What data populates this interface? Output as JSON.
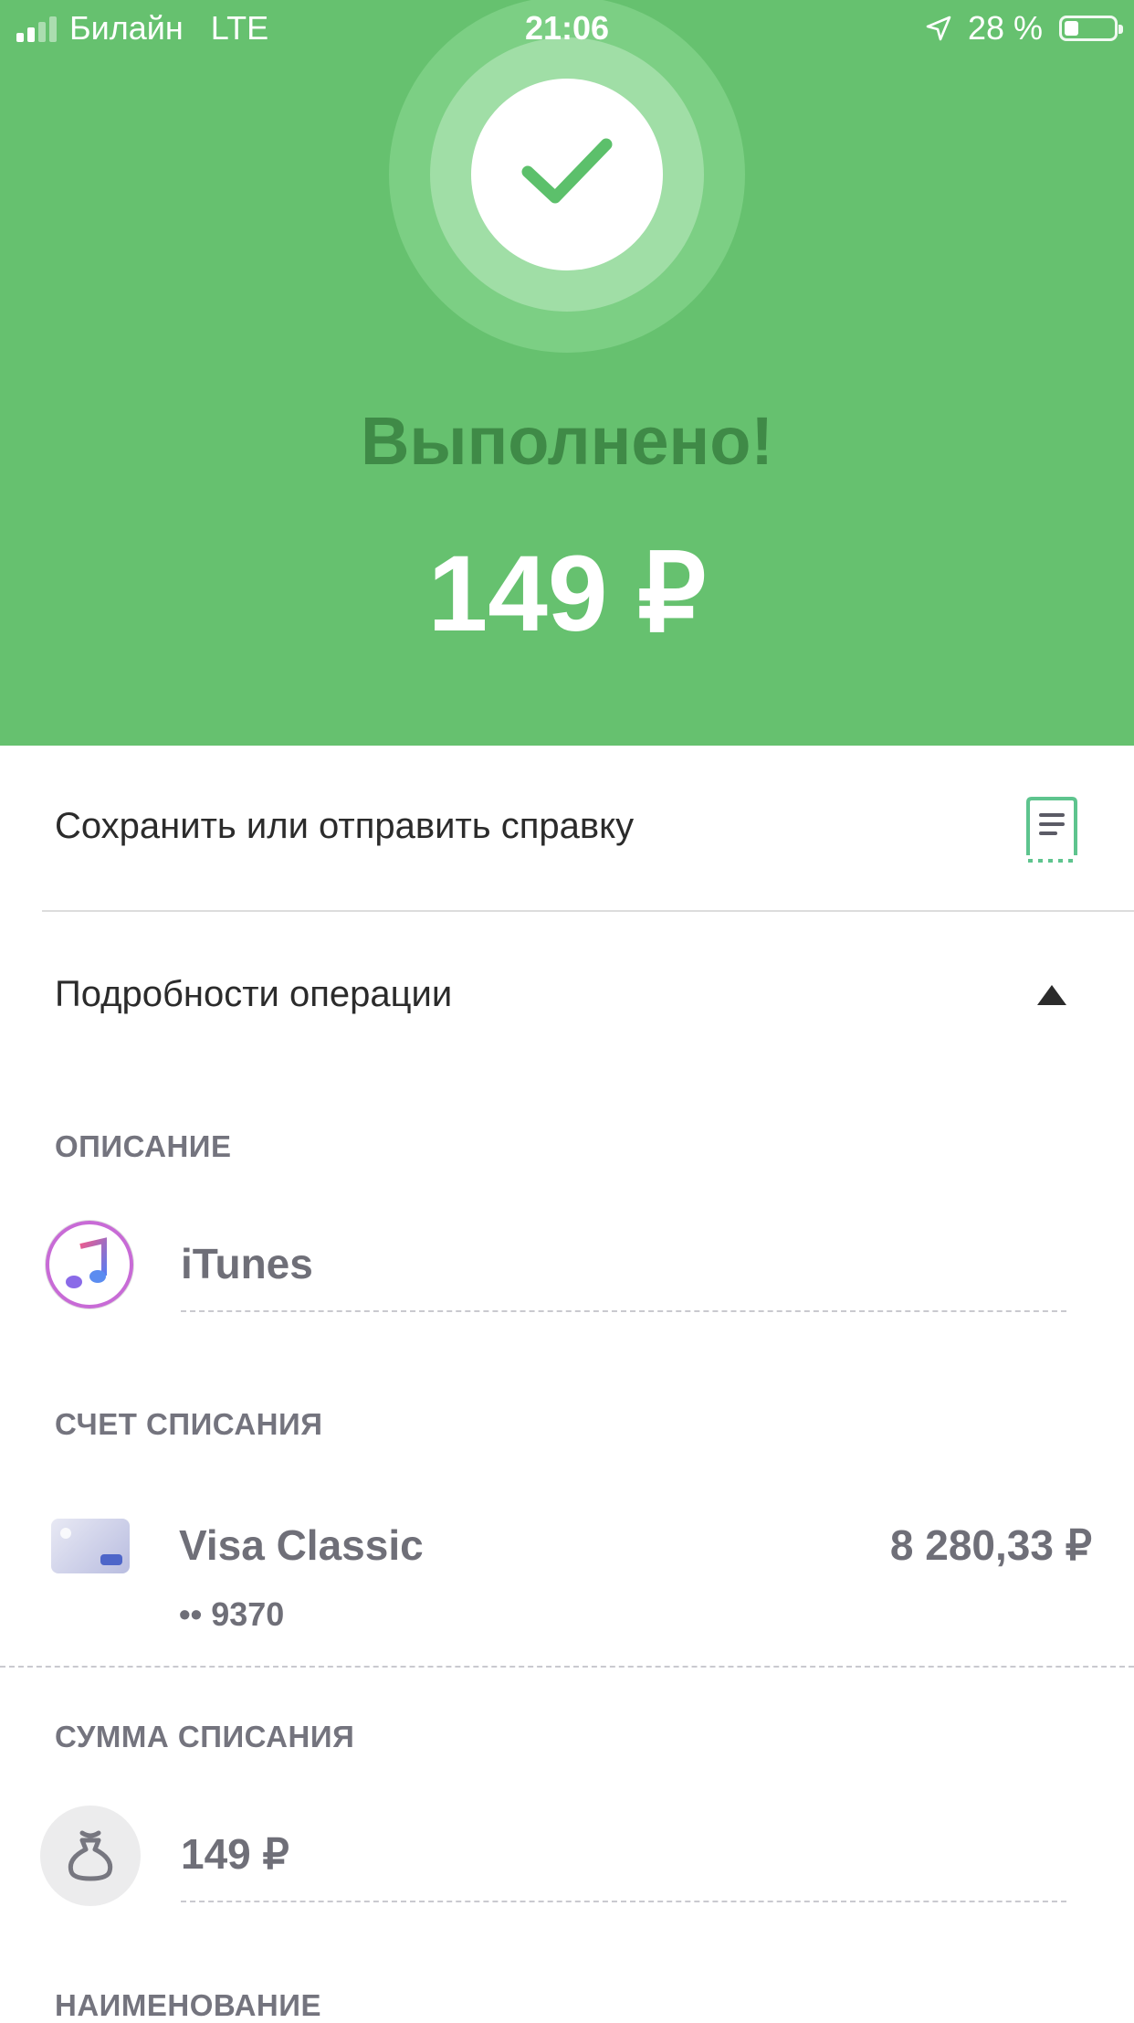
{
  "status_bar": {
    "carrier": "Билайн",
    "network": "LTE",
    "time": "21:06",
    "battery": "28 %",
    "battery_level": 0.28
  },
  "hero": {
    "title": "Выполнено!",
    "amount": "149 ₽",
    "icon": "checkmark-icon",
    "background_color": "#66c16f"
  },
  "actions": {
    "receipt_label": "Сохранить или отправить справку",
    "receipt_icon": "receipt-icon"
  },
  "details": {
    "header": "Подробности операции",
    "toggle_icon": "triangle-up-icon",
    "description": {
      "label": "ОПИСАНИЕ",
      "value": "iTunes",
      "icon": "itunes-icon"
    },
    "account": {
      "label": "СЧЕТ СПИСАНИЯ",
      "name": "Visa Classic",
      "balance": "8 280,33 ₽",
      "number": "•• 9370",
      "icon": "card-icon"
    },
    "amount": {
      "label": "СУММА СПИСАНИЯ",
      "value": "149 ₽",
      "icon": "money-bag-icon"
    },
    "name_label": "НАИМЕНОВАНИЕ"
  }
}
